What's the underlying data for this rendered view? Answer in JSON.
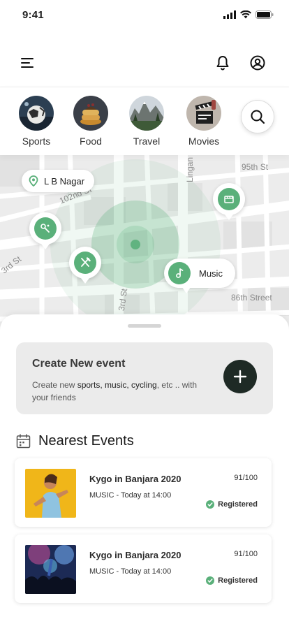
{
  "status": {
    "time": "9:41"
  },
  "topbar": {
    "menu_icon": "menu-icon",
    "bell_icon": "bell-icon",
    "profile_icon": "user-circle-icon"
  },
  "categories": [
    {
      "label": "Sports"
    },
    {
      "label": "Food"
    },
    {
      "label": "Travel"
    },
    {
      "label": "Movies"
    }
  ],
  "map": {
    "location_label": "L B Nagar",
    "streets": {
      "s1": "95th St",
      "s2": "102nd St",
      "s3": "3rd St",
      "s4": "3rd St",
      "s5": "86th Street",
      "s6": "Lingan"
    },
    "music_label": "Music",
    "accent_color": "#5ab07a"
  },
  "create": {
    "title": "Create New event",
    "desc_prefix": "Create new ",
    "desc_highlight": "sports, music, cycling",
    "desc_suffix": ", etc .. with your friends"
  },
  "nearest": {
    "title": "Nearest Events"
  },
  "events": [
    {
      "name": "Kygo in Banjara 2020",
      "category_time": "MUSIC - Today at 14:00",
      "score": "91/100",
      "status": "Registered"
    },
    {
      "name": "Kygo in Banjara 2020",
      "category_time": "MUSIC - Today at 14:00",
      "score": "91/100",
      "status": "Registered"
    }
  ]
}
